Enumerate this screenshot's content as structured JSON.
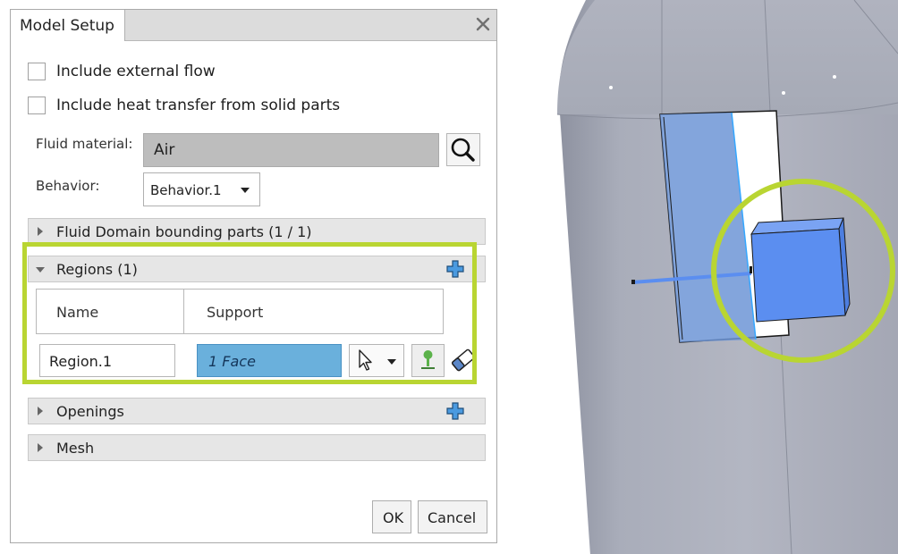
{
  "dialog": {
    "tab_title": "Model Setup",
    "close_icon": "close-icon"
  },
  "options": {
    "external_flow_label": "Include external flow",
    "external_flow_checked": false,
    "heat_transfer_label": "Include heat transfer from solid parts",
    "heat_transfer_checked": false
  },
  "fluid_material": {
    "label": "Fluid material:",
    "value": "Air",
    "search_icon": "search-icon"
  },
  "behavior": {
    "label": "Behavior:",
    "value": "Behavior.1"
  },
  "sections": {
    "bounding_parts": "Fluid Domain bounding parts (1 / 1)",
    "regions": "Regions (1)",
    "openings": "Openings",
    "mesh": "Mesh"
  },
  "regions_table": {
    "columns": [
      "Name",
      "Support"
    ],
    "rows": [
      {
        "name": "Region.1",
        "support": "1 Face"
      }
    ]
  },
  "footer": {
    "ok_label": "OK",
    "cancel_label": "Cancel"
  },
  "colors": {
    "highlight": "#b9d532",
    "selection": "#6ab0dc",
    "model_body": "#a9adbb",
    "region_fill": "#5b8ef0"
  }
}
